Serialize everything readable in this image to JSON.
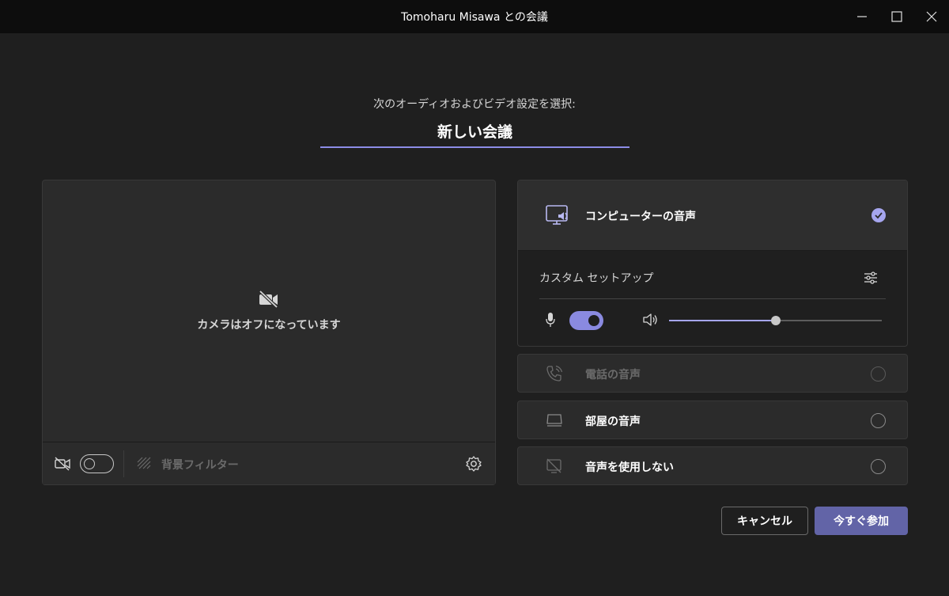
{
  "window": {
    "title": "Tomoharu Misawa との会議",
    "minimize_icon": "minimize-icon",
    "maximize_icon": "maximize-icon",
    "close_icon": "close-icon"
  },
  "header": {
    "subtitle": "次のオーディオおよびビデオ設定を選択:",
    "meeting_name": "新しい会議"
  },
  "video": {
    "camera_off_text": "カメラはオフになっています",
    "camera_toggle_on": false,
    "background_filter_label": "背景フィルター"
  },
  "audio": {
    "selected": "computer",
    "computer": {
      "label": "コンピューターの音声",
      "custom_setup_label": "カスタム セットアップ",
      "mic_on": true,
      "volume_fraction": 0.5
    },
    "options": [
      {
        "id": "phone",
        "label": "電話の音声",
        "disabled": true
      },
      {
        "id": "room",
        "label": "部屋の音声",
        "disabled": false
      },
      {
        "id": "none",
        "label": "音声を使用しない",
        "disabled": false
      }
    ]
  },
  "actions": {
    "cancel_label": "キャンセル",
    "join_label": "今すぐ参加"
  },
  "colors": {
    "accent": "#8a8ae0",
    "join_button": "#6264a7",
    "background": "#1f1f1f",
    "titlebar": "#0d0d0d"
  }
}
